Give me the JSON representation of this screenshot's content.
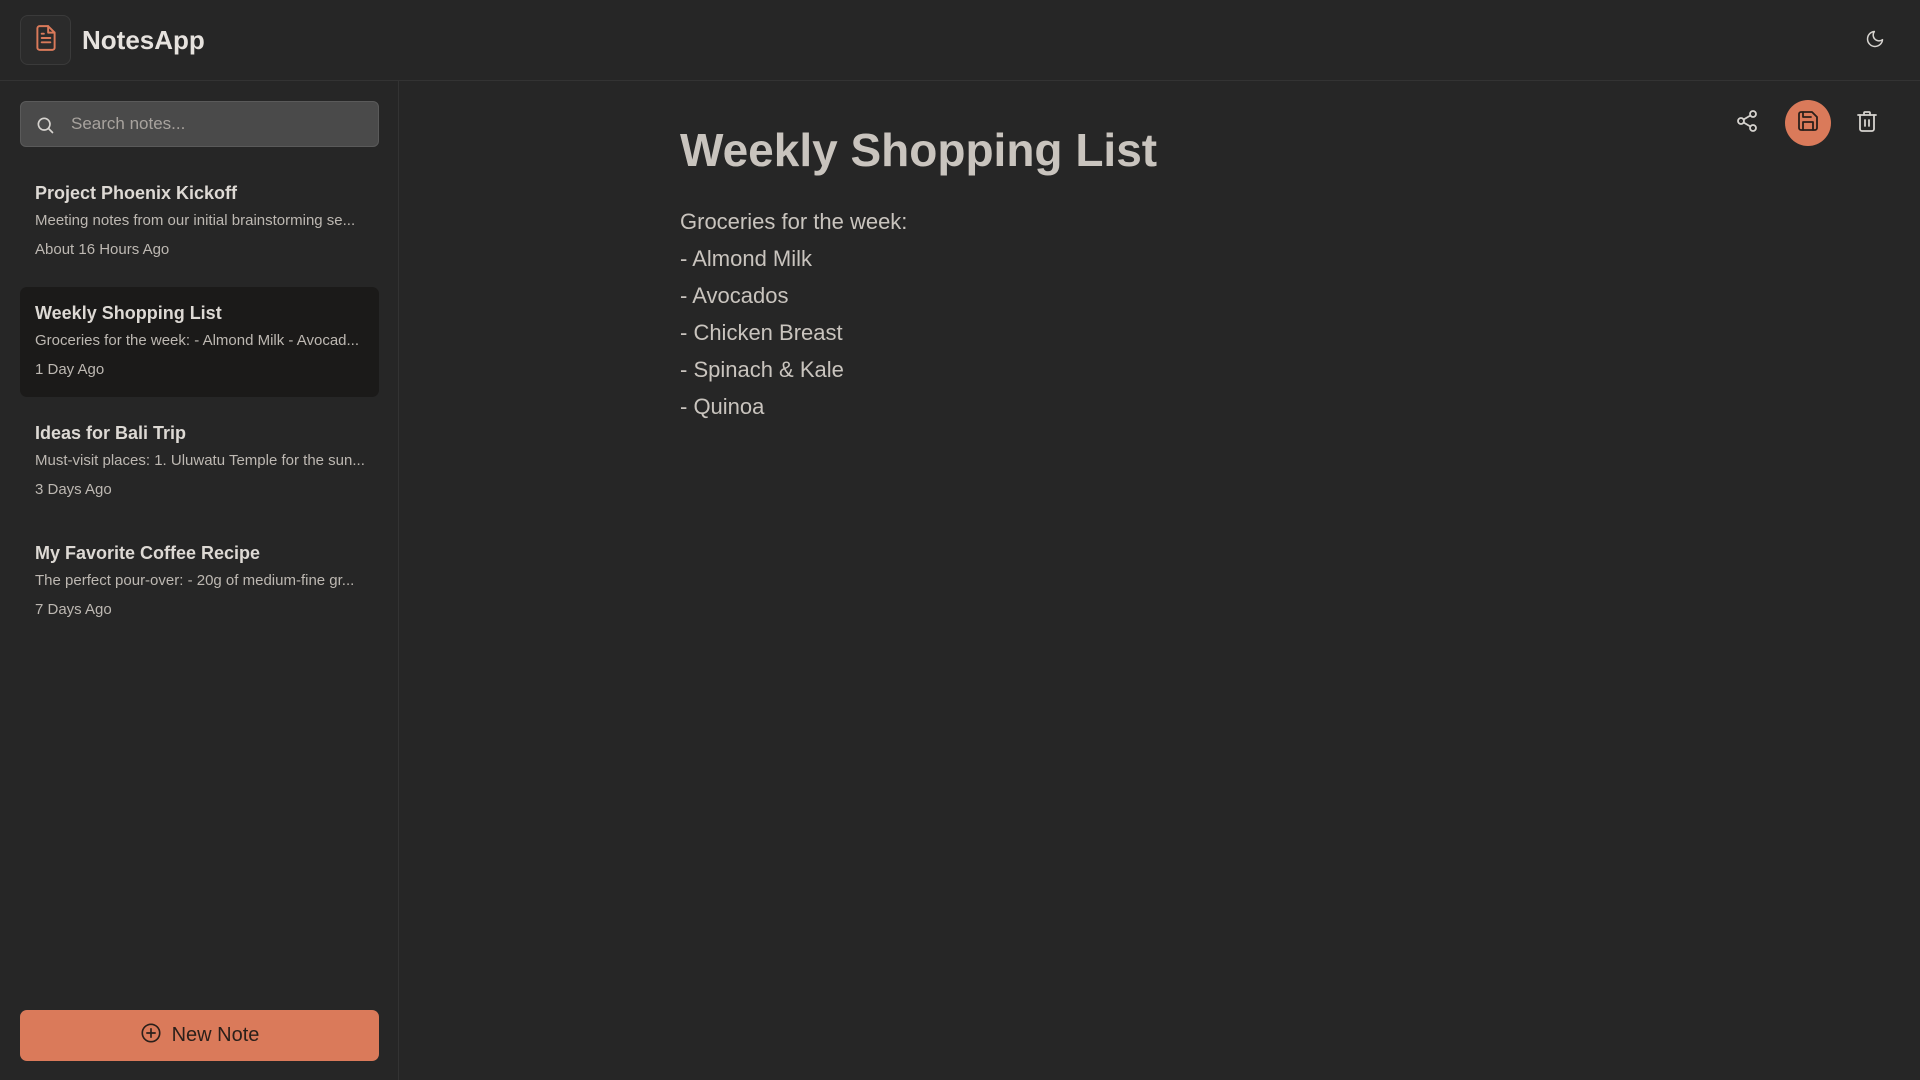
{
  "app": {
    "title": "NotesApp",
    "logo_icon": "document-icon",
    "theme_toggle_icon": "moon-icon",
    "accent_color": "#da7a5a"
  },
  "search": {
    "placeholder": "Search notes...",
    "value": ""
  },
  "notes": [
    {
      "title": "Project Phoenix Kickoff",
      "preview": "Meeting notes from our initial brainstorming se...",
      "time": "About 16 Hours Ago",
      "active": false
    },
    {
      "title": "Weekly Shopping List",
      "preview": "Groceries for the week: - Almond Milk - Avocad...",
      "time": "1 Day Ago",
      "active": true
    },
    {
      "title": "Ideas for Bali Trip",
      "preview": "Must-visit places: 1. Uluwatu Temple for the sun...",
      "time": "3 Days Ago",
      "active": false
    },
    {
      "title": "My Favorite Coffee Recipe",
      "preview": "The perfect pour-over: - 20g of medium-fine gr...",
      "time": "7 Days Ago",
      "active": false
    }
  ],
  "new_note": {
    "label": "New Note",
    "icon": "plus-circle-icon"
  },
  "toolbar": {
    "share_icon": "share-icon",
    "save_icon": "save-icon",
    "delete_icon": "trash-icon"
  },
  "editor": {
    "title": "Weekly Shopping List",
    "lines": [
      "Groceries for the week:",
      "- Almond Milk",
      "- Avocados",
      "- Chicken Breast",
      "- Spinach & Kale",
      "- Quinoa"
    ]
  }
}
